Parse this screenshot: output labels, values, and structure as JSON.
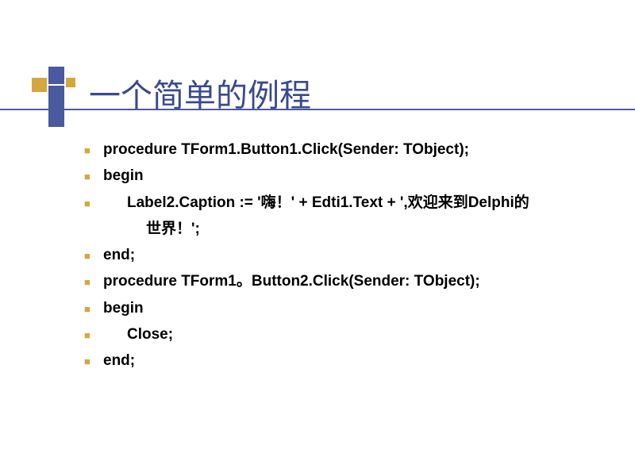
{
  "title": "一个简单的例程",
  "code": {
    "line1": "procedure TForm1.Button1.Click(Sender: TObject);",
    "line2": "begin",
    "line3a": "Label2.Caption := '嗨！' + Edti1.Text + ',欢迎来到Delphi的",
    "line3b": "世界！';",
    "line4": "end;",
    "line5": "procedure TForm1。Button2.Click(Sender: TObject);",
    "line6": "begin",
    "line7": "Close;",
    "line8": "end;"
  }
}
